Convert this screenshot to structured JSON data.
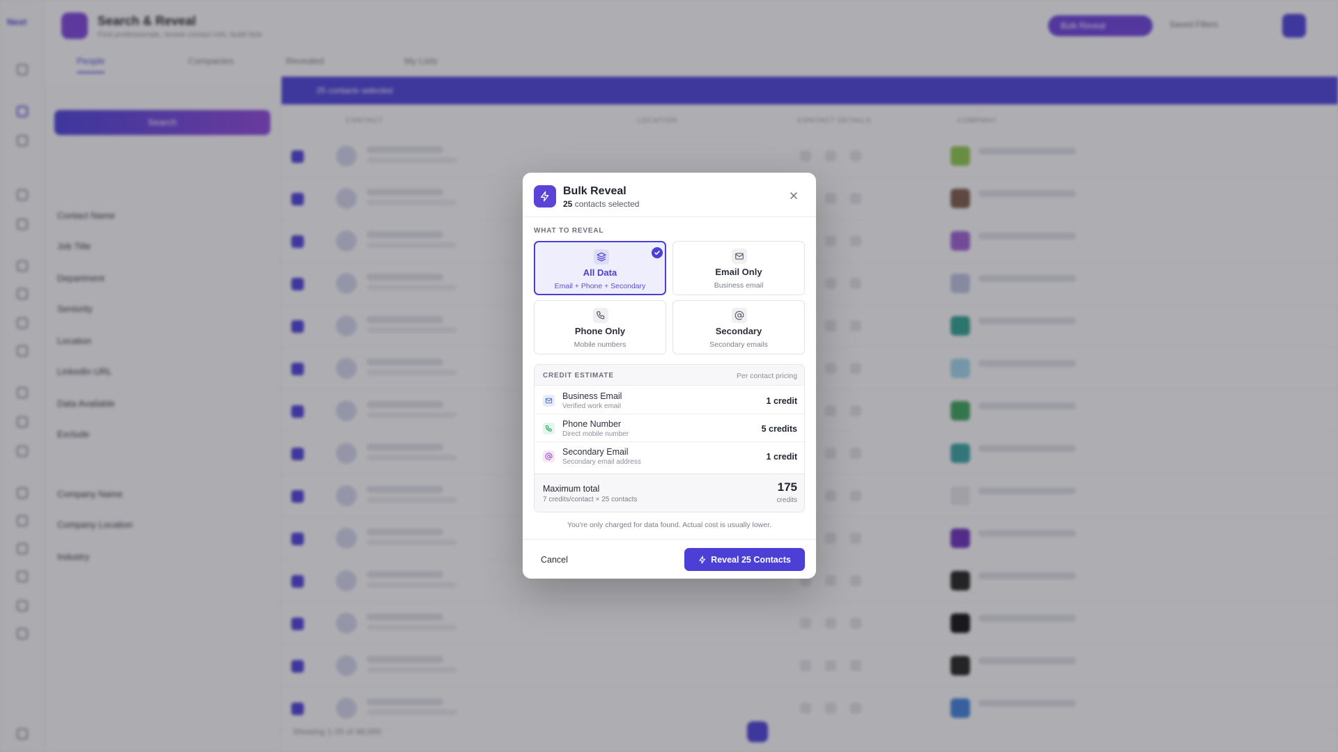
{
  "background": {
    "logo": "Next",
    "app_title": "Search & Reveal",
    "app_subtitle": "Find professionals, reveal contact info, build lists",
    "bulk_reveal_label": "Bulk Reveal",
    "saved_filters_label": "Saved Filters",
    "tabs": [
      "People",
      "Companies",
      "Revealed",
      "My Lists"
    ],
    "search_label": "Search",
    "filter_rows": [
      "Contact Name",
      "Job Title",
      "Department",
      "Seniority",
      "Location",
      "LinkedIn URL",
      "Data Available",
      "Exclude",
      "Company Name",
      "Company Location",
      "Industry"
    ],
    "selection_text": "25 contacts selected",
    "columns": [
      "CONTACT",
      "LOCATION",
      "CONTACT DETAILS",
      "COMPANY"
    ],
    "showing_text": "Showing 1-25 of 48,000"
  },
  "modal": {
    "title": "Bulk Reveal",
    "count": "25",
    "subtitle_suffix": " contacts selected",
    "section_label": "WHAT TO REVEAL",
    "options": [
      {
        "label": "All Data",
        "desc": "Email + Phone + Secondary",
        "icon": "layers-icon",
        "selected": true
      },
      {
        "label": "Email Only",
        "desc": "Business email",
        "icon": "mail-icon",
        "selected": false
      },
      {
        "label": "Phone Only",
        "desc": "Mobile numbers",
        "icon": "phone-icon",
        "selected": false
      },
      {
        "label": "Secondary",
        "desc": "Secondary emails",
        "icon": "at-icon",
        "selected": false
      }
    ],
    "estimate": {
      "title": "CREDIT ESTIMATE",
      "note": "Per contact pricing",
      "rows": [
        {
          "label": "Business Email",
          "desc": "Verified work email",
          "value": "1 credit",
          "icon": "mail-icon",
          "color": "#4b6fd6"
        },
        {
          "label": "Phone Number",
          "desc": "Direct mobile number",
          "value": "5 credits",
          "icon": "phone-icon",
          "color": "#22a55a"
        },
        {
          "label": "Secondary Email",
          "desc": "Secondary email address",
          "value": "1 credit",
          "icon": "at-icon",
          "color": "#a546c9"
        }
      ],
      "total_label": "Maximum total",
      "total_desc": "7 credits/contact × 25 contacts",
      "total_value": "175",
      "total_unit": "credits"
    },
    "footnote": "You're only charged for data found. Actual cost is usually lower.",
    "cancel_label": "Cancel",
    "reveal_label": "Reveal 25 Contacts"
  },
  "colors": {
    "accent": "#4b3fd6",
    "overlay": "rgba(40,40,48,0.35)"
  }
}
